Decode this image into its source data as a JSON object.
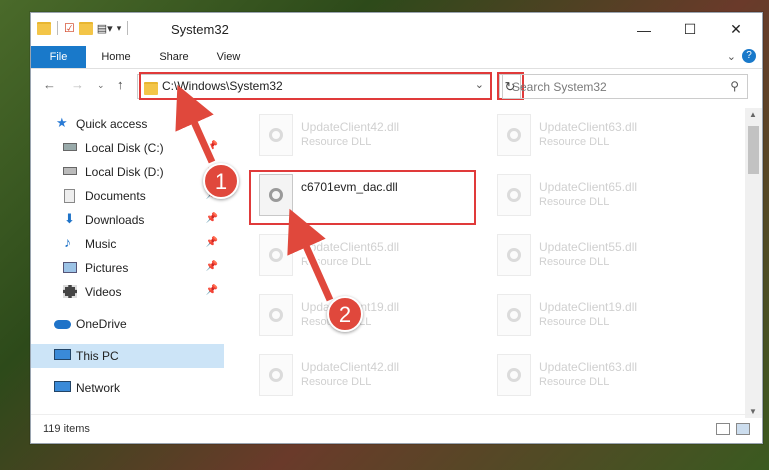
{
  "window": {
    "title": "System32"
  },
  "ribbon": {
    "tabs": [
      "File",
      "Home",
      "Share",
      "View"
    ]
  },
  "nav": {
    "address": "C:\\Windows\\System32",
    "search_placeholder": "Search System32"
  },
  "sidebar": {
    "items": [
      {
        "label": "Quick access",
        "icon": "star-icon"
      },
      {
        "label": "Local Disk (C:)",
        "icon": "drive-icon",
        "pinned": true
      },
      {
        "label": "Local Disk (D:)",
        "icon": "drive-icon",
        "pinned": true
      },
      {
        "label": "Documents",
        "icon": "documents-icon",
        "pinned": true
      },
      {
        "label": "Downloads",
        "icon": "download-icon",
        "pinned": true
      },
      {
        "label": "Music",
        "icon": "music-icon",
        "pinned": true
      },
      {
        "label": "Pictures",
        "icon": "pictures-icon",
        "pinned": true
      },
      {
        "label": "Videos",
        "icon": "videos-icon",
        "pinned": true
      },
      {
        "label": "OneDrive",
        "icon": "cloud-icon"
      },
      {
        "label": "This PC",
        "icon": "computer-icon",
        "selected": true
      },
      {
        "label": "Network",
        "icon": "network-icon"
      }
    ]
  },
  "files": [
    {
      "name": "UpdateClient42.dll",
      "type": "Resource DLL",
      "faded": true
    },
    {
      "name": "UpdateClient63.dll",
      "type": "Resource DLL",
      "faded": true
    },
    {
      "name": "c6701evm_dac.dll",
      "type": "",
      "faded": false
    },
    {
      "name": "UpdateClient65.dll",
      "type": "Resource DLL",
      "faded": true
    },
    {
      "name": "UpdateClient65.dll",
      "type": "Resource DLL",
      "faded": true
    },
    {
      "name": "UpdateClient55.dll",
      "type": "Resource DLL",
      "faded": true
    },
    {
      "name": "UpdateClient19.dll",
      "type": "Resource DLL",
      "faded": true
    },
    {
      "name": "UpdateClient19.dll",
      "type": "Resource DLL",
      "faded": true
    },
    {
      "name": "UpdateClient42.dll",
      "type": "Resource DLL",
      "faded": true
    },
    {
      "name": "UpdateClient63.dll",
      "type": "Resource DLL",
      "faded": true
    }
  ],
  "status": {
    "items": "119 items"
  },
  "annotations": {
    "step1": "1",
    "step2": "2",
    "color": "#e0483c"
  }
}
